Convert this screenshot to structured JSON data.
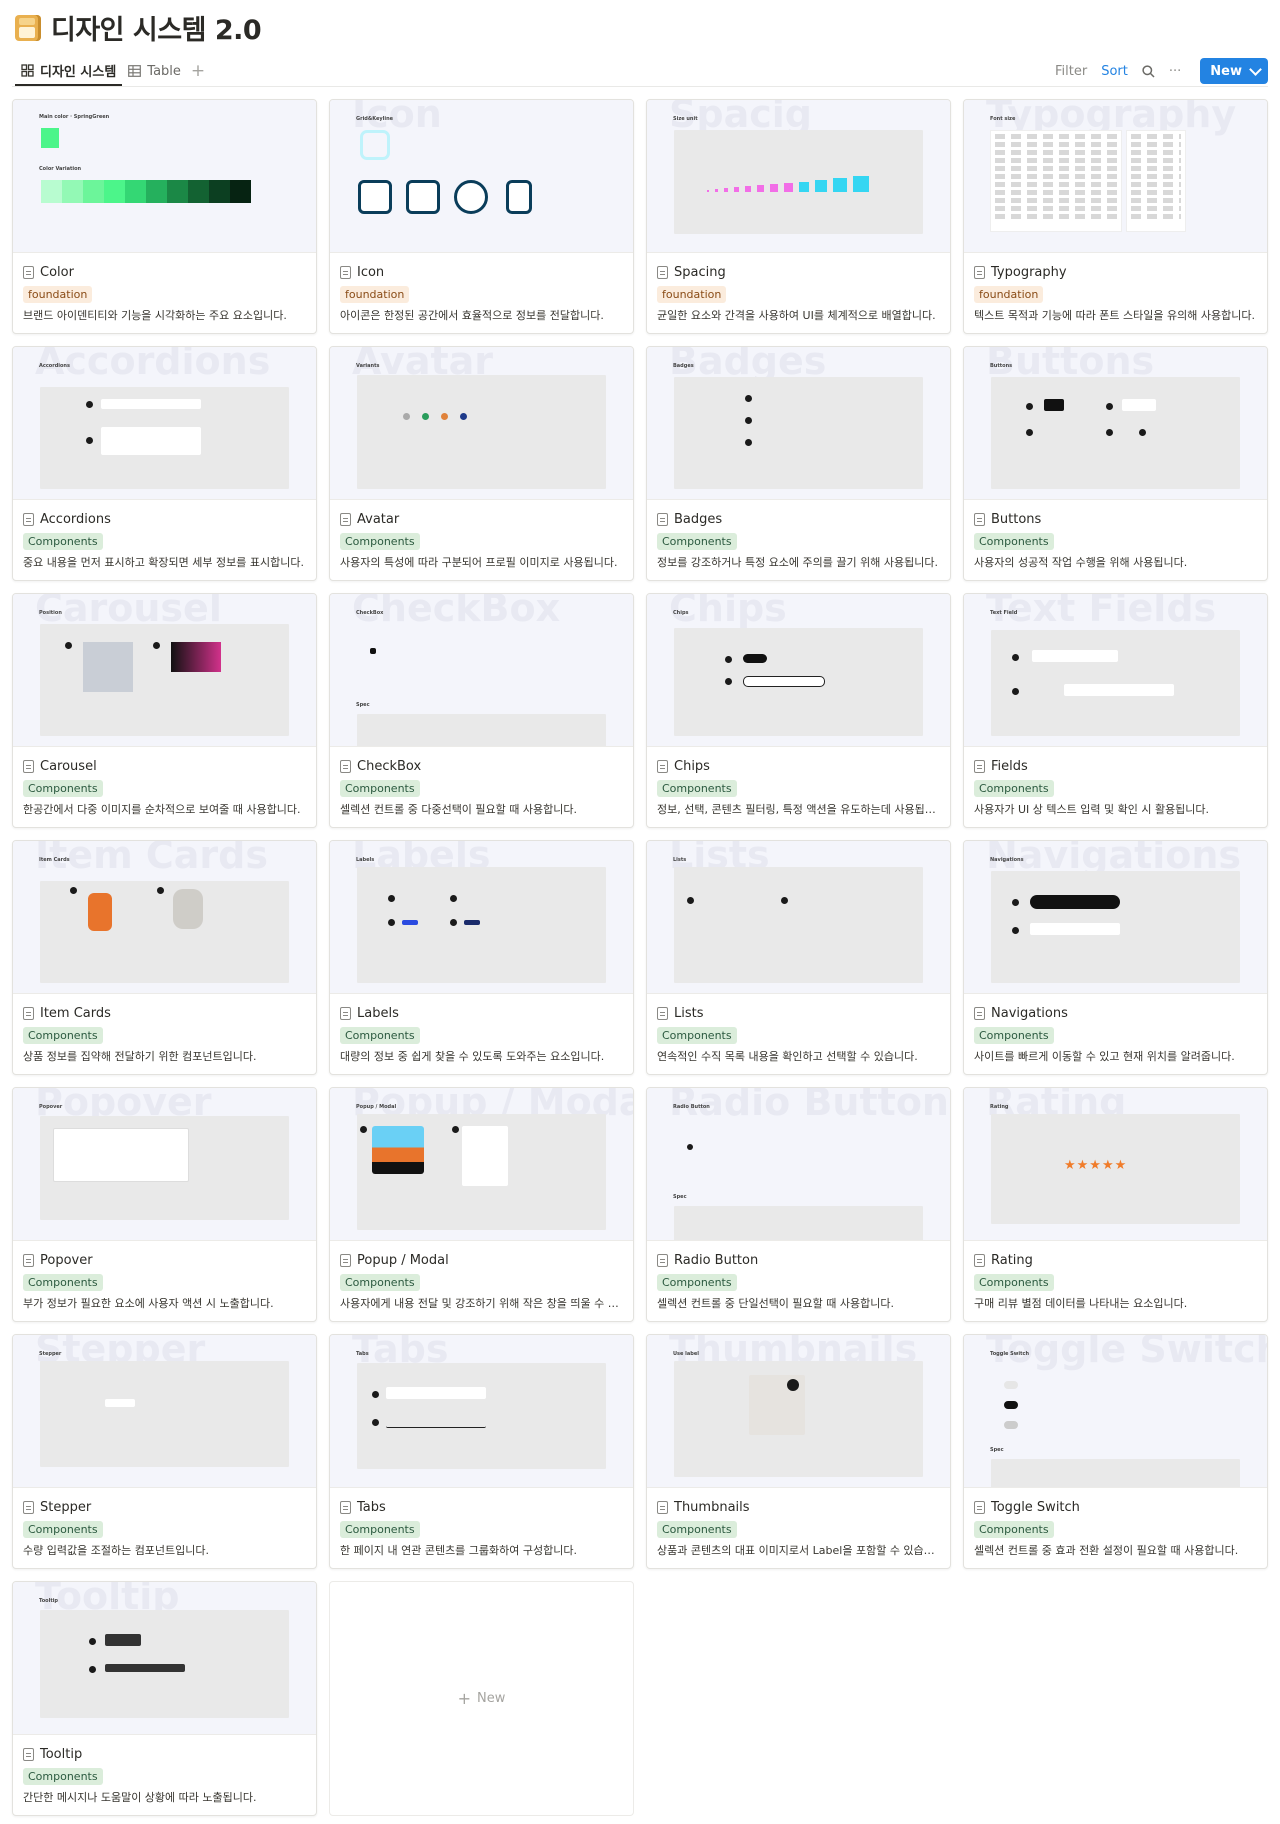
{
  "page": {
    "title": "디자인 시스템 2.0"
  },
  "toolbar": {
    "views": [
      {
        "label": "디자인 시스템"
      },
      {
        "label": "Table"
      }
    ],
    "add_view": "+",
    "filter": "Filter",
    "sort": "Sort",
    "more": "···",
    "new": "New"
  },
  "cards": [
    {
      "name": "Color",
      "tag": "foundation",
      "desc": "브랜드 아이덴티티와 기능을 시각화하는 주요 요소입니다.",
      "watermark": ""
    },
    {
      "name": "Icon",
      "tag": "foundation",
      "desc": "아이콘은 한정된 공간에서 효율적으로 정보를 전달합니다.",
      "watermark": "Icon"
    },
    {
      "name": "Spacing",
      "tag": "foundation",
      "desc": "균일한 요소와 간격을 사용하여 UI를 체계적으로 배열합니다.",
      "watermark": "Spacig"
    },
    {
      "name": "Typography",
      "tag": "foundation",
      "desc": "텍스트 목적과 기능에 따라 폰트 스타일을 유의해 사용합니다.",
      "watermark": "Typography"
    },
    {
      "name": "Accordions",
      "tag": "Components",
      "desc": "중요 내용을 먼저 표시하고 확장되면 세부 정보를 표시합니다.",
      "watermark": "Accordions"
    },
    {
      "name": "Avatar",
      "tag": "Components",
      "desc": "사용자의 특성에 따라 구분되어 프로필 이미지로 사용됩니다.",
      "watermark": "Avatar"
    },
    {
      "name": "Badges",
      "tag": "Components",
      "desc": "정보를 강조하거나 특정 요소에 주의를 끌기 위해 사용됩니다.",
      "watermark": "Badges"
    },
    {
      "name": "Buttons",
      "tag": "Components",
      "desc": "사용자의 성공적 작업 수행을 위해 사용됩니다.",
      "watermark": "Buttons"
    },
    {
      "name": "Carousel",
      "tag": "Components",
      "desc": "한공간에서 다중 이미지를 순차적으로 보여줄 때 사용합니다.",
      "watermark": "Carousel"
    },
    {
      "name": "CheckBox",
      "tag": "Components",
      "desc": "셀렉션 컨트롤 중 다중선택이 필요할 때 사용합니다.",
      "watermark": "CheckBox"
    },
    {
      "name": "Chips",
      "tag": "Components",
      "desc": "정보, 선택, 콘텐츠 필터링, 특정 액션을 유도하는데 사용됩니다.",
      "watermark": "Chips"
    },
    {
      "name": "Fields",
      "tag": "Components",
      "desc": "사용자가 UI 상 텍스트 입력 및 확인 시 활용됩니다.",
      "watermark": "Text Fields"
    },
    {
      "name": "Item Cards",
      "tag": "Components",
      "desc": "상품 정보를 집약해 전달하기 위한 컴포넌트입니다.",
      "watermark": "Item Cards"
    },
    {
      "name": "Labels",
      "tag": "Components",
      "desc": "대량의 정보 중 쉽게 찾을 수 있도록 도와주는 요소입니다.",
      "watermark": "Labels"
    },
    {
      "name": "Lists",
      "tag": "Components",
      "desc": "연속적인 수직 목록 내용을 확인하고 선택할 수 있습니다.",
      "watermark": "Lists"
    },
    {
      "name": "Navigations",
      "tag": "Components",
      "desc": "사이트를 빠르게 이동할 수 있고 현재 위치를 알려줍니다.",
      "watermark": "Navigations"
    },
    {
      "name": "Popover",
      "tag": "Components",
      "desc": "부가 정보가 필요한 요소에 사용자 액션 시 노출합니다.",
      "watermark": "Popover"
    },
    {
      "name": "Popup / Modal",
      "tag": "Components",
      "desc": "사용자에게 내용 전달 및 강조하기 위해 작은 창을 띄울 수 있습니다.",
      "watermark": "Popup / Modal"
    },
    {
      "name": "Radio Button",
      "tag": "Components",
      "desc": "셀렉션 컨트롤 중 단일선택이 필요할 때 사용합니다.",
      "watermark": "Radio Button"
    },
    {
      "name": "Rating",
      "tag": "Components",
      "desc": "구매 리뷰 별점 데이터를 나타내는 요소입니다.",
      "watermark": "Rating"
    },
    {
      "name": "Stepper",
      "tag": "Components",
      "desc": "수량 입력값을 조절하는 컴포넌트입니다.",
      "watermark": "Stepper"
    },
    {
      "name": "Tabs",
      "tag": "Components",
      "desc": "한 페이지 내 연관 콘텐츠를 그룹화하여 구성합니다.",
      "watermark": "Tabs"
    },
    {
      "name": "Thumbnails",
      "tag": "Components",
      "desc": "상품과 콘텐츠의 대표 이미지로서 Label을 포함할 수 있습니다.",
      "watermark": "Thumbnails"
    },
    {
      "name": "Toggle Switch",
      "tag": "Components",
      "desc": "셀렉션 컨트롤 중 효과 전환 설정이 필요할 때 사용합니다.",
      "watermark": "Toggle Switch"
    },
    {
      "name": "Tooltip",
      "tag": "Components",
      "desc": "간단한 메시지나 도움말이 상황에 따라 노출됩니다.",
      "watermark": "Tooltip"
    }
  ],
  "new_card": {
    "label": "New"
  },
  "colors": {
    "accent": "#2383e2",
    "foundation_tag": "#fbecdd",
    "components_tag": "#dbeddb"
  }
}
